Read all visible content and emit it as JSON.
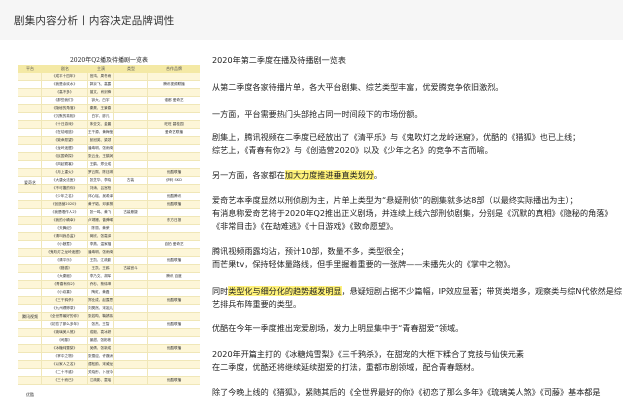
{
  "header": {
    "title": "剧集内容分析丨内容决定品牌调性"
  },
  "table": {
    "title": "2020年Q2播及待播剧一览表",
    "columns": [
      "平台",
      "剧名",
      "主演",
      "类型",
      "合作品牌"
    ],
    "groups": [
      {
        "label": "爱奇艺"
      },
      {
        "label": "腾讯视频"
      },
      {
        "label": "优酷"
      }
    ],
    "rows": [
      [
        "",
        "《成平十四年》",
        "官鸿、周冬雨",
        "",
        ""
      ],
      [
        "",
        "《我是余欢水》",
        "郭京飞、高露",
        "",
        "腾讯视频联播"
      ],
      [
        "",
        "《高不多》",
        "曾文、肖剑锋",
        "",
        ""
      ],
      [
        "",
        "《那些我们》",
        "钟大、白宇",
        "",
        "谁都 爱奇艺"
      ],
      [
        "",
        "《隐秘的角落》",
        "秦昊、王景春",
        "",
        ""
      ],
      [
        "",
        "《沉默的真相》",
        "白宇、廖凡",
        "",
        ""
      ],
      [
        "",
        "《十日游戏》",
        "朱亚文、金晨",
        "",
        "旺旺 碧桂园"
      ],
      [
        "",
        "《在劫难逃》",
        "王千源、黄梅莹",
        "",
        "爱奇艺联播"
      ],
      [
        "",
        "《致命愿望》",
        "彭冠英、梁颂",
        "",
        ""
      ],
      [
        "",
        "《龙岭迷窟》",
        "潘粤明、张雨绮",
        "",
        ""
      ],
      [
        "",
        "《民国奇探》",
        "张云龙、王鹤润",
        "",
        ""
      ],
      [
        "",
        "《风起霓裳》",
        "王鹤、郑业成",
        "",
        ""
      ],
      [
        "",
        "《月上重火》",
        "罗云熙、陈钰琪",
        "",
        "优酷联播"
      ],
      [
        "",
        "《大唐女法医》",
        "张芝华、李晓",
        "古装",
        "伊利 SKD"
      ],
      [
        "",
        "《不可靠的你》",
        "刘涛、吕宫柏",
        "",
        ""
      ],
      [
        "",
        "《少年之名》",
        "邓心瑶、吴希泽",
        "",
        "优酷腾讯"
      ],
      [
        "",
        "《创造营2020》",
        "黄子韬、邓紫棋",
        "",
        "优酷联播"
      ],
      [
        "",
        "《我是唱作人2》",
        "张一鸣、黄飞",
        "古装悬疑",
        ""
      ],
      [
        "",
        "《我的小确幸》",
        "卢靖姗、曾舜晞",
        "",
        "东方日报"
      ],
      [
        "",
        "《天舞纪》",
        "陈丽、黄荣",
        "",
        ""
      ],
      [
        "",
        "《请叫我总监》",
        "蒋欣、张嘉译",
        "",
        ""
      ],
      [
        "",
        "《小娘惹》",
        "李燕、温家福",
        "",
        "自拍 爱奇艺"
      ],
      [
        "",
        "《鬼吹灯之龙岭迷窟》",
        "潘粤明、张雨绮",
        "",
        ""
      ],
      [
        "",
        "《清平乐》",
        "王凯、江疏影",
        "",
        "优酷联播"
      ],
      [
        "",
        "《猎狐》",
        "王凯、王鸥",
        "古装宫斗",
        ""
      ],
      [
        "",
        "《大秦赋》",
        "李乃文、胡军",
        "",
        "腾讯 百度"
      ],
      [
        "",
        "《青春有你2》",
        "乔杉、蔡徐坤",
        "",
        ""
      ],
      [
        "",
        "《小欢喜》",
        "陶虹、黄磊",
        "",
        ""
      ],
      [
        "",
        "《三千鸦杀》",
        "郑业成、赵露思",
        "",
        "优酷联播"
      ],
      [
        "",
        "《九州缥缈录》",
        "刘昊然、宋祖儿",
        "",
        ""
      ],
      [
        "",
        "《全世界最好的你》",
        "张若昀、鞠婧祎",
        "",
        ""
      ],
      [
        "",
        "《初恋了那么多年》",
        "张杰、王智",
        "",
        "优酷联播"
      ],
      [
        "",
        "《琉璃美人煞》",
        "成毅、袁冰妍",
        "",
        ""
      ],
      [
        "",
        "《司藤》",
        "景甜、张彬彬",
        "",
        ""
      ],
      [
        "",
        "《冰糖炖雪梨》",
        "吴倩、张新成",
        "",
        "优酷联播"
      ],
      [
        "",
        "《掌中之物》",
        "张雪迎、许魏洲",
        "",
        ""
      ],
      [
        "",
        "《以家人之名》",
        "谭松韵、宋威龙",
        "",
        ""
      ],
      [
        "",
        "《二十不惑》",
        "关晓彤、卜冠今",
        "",
        ""
      ],
      [
        "",
        "《三十而已》",
        "江疏影、童瑶",
        "",
        "优酷联播"
      ]
    ]
  },
  "paragraphs": [
    {
      "id": "p1",
      "segments": [
        {
          "text": "2020年第二季度在播及待播剧一览表"
        }
      ]
    },
    {
      "id": "p2",
      "segments": [
        {
          "text": "从第二季度各家待播片单，各大平台剧集、综艺类型丰富，优爱腾竞争依旧激烈。"
        }
      ]
    },
    {
      "id": "p3",
      "segments": [
        {
          "text": "一方面，平台需要热门头部抢占同一时间段下的市场份额。"
        }
      ]
    },
    {
      "id": "p4",
      "segments": [
        {
          "text": "剧集上，腾讯视频在二季度已经放出了《清平乐》与《鬼吹灯之龙岭迷窟》，优酷的《猎狐》也已上线；"
        }
      ]
    },
    {
      "id": "p5",
      "segments": [
        {
          "text": "综艺上，《青春有你2》与《创造营2020》以及《少年之名》的竞争不言而喻。"
        }
      ]
    },
    {
      "id": "p6",
      "segments": [
        {
          "text": "另一方面，各家都在"
        },
        {
          "text": "加大力度推进垂直类划分",
          "hl": true
        },
        {
          "text": "。"
        }
      ]
    },
    {
      "id": "p7",
      "segments": [
        {
          "text": "爱奇艺本季度显然以刑侦剧为主，片单上类型为“悬疑刑侦”的剧集就多达8部（以最终实际播出为主）；"
        }
      ]
    },
    {
      "id": "p8",
      "segments": [
        {
          "text": "有消息称爱奇艺将于2020年Q2推出正义剧场，并连续上线六部刑侦剧集，分别是《沉默的真相》《隐秘的角落》"
        }
      ]
    },
    {
      "id": "p9",
      "segments": [
        {
          "text": "《非常目击》《在劫难逃》《十日游戏》《致命愿望》。"
        }
      ]
    },
    {
      "id": "p10",
      "segments": [
        {
          "text": "腾讯视频雨露均沾，预计10部，数量不多，类型很全；"
        }
      ]
    },
    {
      "id": "p11",
      "segments": [
        {
          "text": "而芒果tv，保持轻体量路线，但手里握着重要的一张牌——未播先火的《掌中之物》。"
        }
      ]
    },
    {
      "id": "p12",
      "segments": [
        {
          "text": "同时"
        },
        {
          "text": "类型化与细分化的趋势越发明显",
          "hl": true
        },
        {
          "text": "，悬疑短剧占据不少篇幅，IP效应显著；带货类增多，观察类与综N代依然是综"
        }
      ]
    },
    {
      "id": "p13",
      "segments": [
        {
          "text": "艺排兵布阵重要的类型。"
        }
      ]
    },
    {
      "id": "p14",
      "segments": [
        {
          "text": "优酷在今年一季度推出宠爱剧场，发力上明显集中于“青春甜爱”领域。"
        }
      ]
    },
    {
      "id": "p15",
      "segments": [
        {
          "text": "2020年开篇主打的《冰糖炖雪梨》《三千鸦杀》，在甜宠的大框下糅合了竞技与仙侠元素"
        }
      ]
    },
    {
      "id": "p16",
      "segments": [
        {
          "text": "在二季度，优酷还将继续延续甜爱的打法，重都市剧领域，配合青春题材。"
        }
      ]
    },
    {
      "id": "p17",
      "segments": [
        {
          "text": "除了今晚上线的《猎狐》，紧随其后的《全世界最好的你》《初恋了那么多年》《琉璃美人煞》《司藤》基本都是"
        }
      ]
    }
  ]
}
